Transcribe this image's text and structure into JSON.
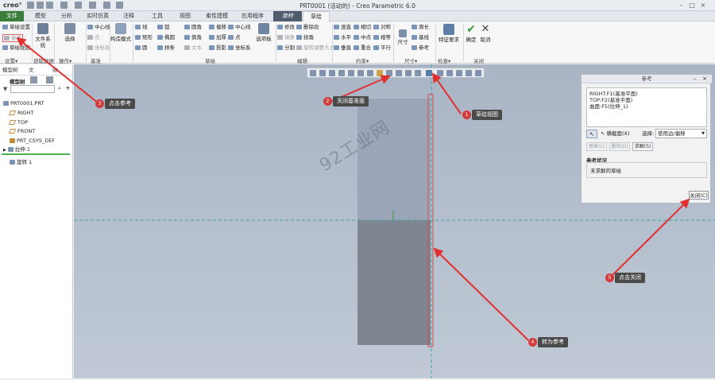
{
  "titlebar": {
    "logo": "creo°",
    "title": "PRT0001 (活动的) - Creo Parametric 6.0"
  },
  "tabs": {
    "file": "文件",
    "items": [
      "模型",
      "分析",
      "实时仿真",
      "注释",
      "工具",
      "视图",
      "柔性建模",
      "应用程序"
    ],
    "context": "旋转",
    "active": "草绘"
  },
  "ribbon": {
    "setup": {
      "sketch_setup": "草绘设置",
      "references": "参考",
      "sketch_view": "草绘视图",
      "label": "设置▾"
    },
    "get_data": {
      "file_system": "文件系统",
      "label": "获取数据"
    },
    "operations": {
      "select": "选择",
      "label": "操作▾"
    },
    "datum": {
      "centerline": "中心线",
      "point": "点",
      "csys": "坐标系",
      "label": "基准"
    },
    "construction": {
      "label": "构造模式"
    },
    "sketch": {
      "line": "线",
      "rectangle": "矩形",
      "circle": "圆",
      "arc": "弧",
      "ellipse": "椭圆",
      "spline": "样条",
      "fillet": "圆角",
      "chamfer": "倒角",
      "text": "文本",
      "offset": "偏移",
      "thicken": "加厚",
      "project": "投影",
      "centerline": "中心线",
      "point": "点",
      "csys": "坐标系",
      "palette": "选项板",
      "label": "草绘"
    },
    "editing": {
      "modify": "修改",
      "delete_segment": "删除段",
      "mirror": "镜像",
      "corner": "拐角",
      "divide": "分割",
      "rotate_resize": "旋转调整大小",
      "label": "编辑"
    },
    "constrain": {
      "vertical": "竖直",
      "horizontal": "水平",
      "perpendicular": "垂直",
      "tangent": "相切",
      "midpoint": "中点",
      "coincident": "重合",
      "symmetric": "对称",
      "equal": "相等",
      "parallel": "平行",
      "label": "约束▾"
    },
    "dimension": {
      "dimension": "尺寸",
      "perimeter": "周长",
      "baseline": "基线",
      "reference": "参考",
      "label": "尺寸▾"
    },
    "inspect": {
      "feature_req": "特征要求",
      "label": "检查▾"
    },
    "close": {
      "ok": "确定",
      "cancel": "取消",
      "label": "关闭"
    }
  },
  "left_panel": {
    "tabs": [
      "模型树",
      "文",
      "收"
    ],
    "tree_label": "模型树",
    "items": [
      "PRT0001.PRT",
      "RIGHT",
      "TOP",
      "FRONT",
      "PRT_CSYS_DEF",
      "拉伸 1",
      "旋转 1"
    ]
  },
  "ref_dialog": {
    "title": "参考",
    "references": [
      "RIGHT:F1(基准平面)",
      "TOP:F2(基准平面)",
      "曲面:F5(拉伸_1)"
    ],
    "xsec_label": "横截面(X)",
    "select_label": "选择:",
    "select_value": "使用边/偏移",
    "replace": "替换(L)",
    "delete": "删除(D)",
    "solve": "求解(S)",
    "status_label": "参考状况",
    "status_value": "未求解的草绘",
    "close": "关闭(C)"
  },
  "annotations": [
    {
      "num": "1",
      "text": "草绘视图"
    },
    {
      "num": "2",
      "text": "关闭基准面"
    },
    {
      "num": "3",
      "text": "点击参考"
    },
    {
      "num": "4",
      "text": "转为参考"
    },
    {
      "num": "5",
      "text": "点击关闭"
    }
  ],
  "watermark": "92工业网",
  "colors": {
    "file_tab": "#3b7d3b",
    "annotation_red": "#d23b3b",
    "datum_line": "#3aa6a6",
    "solid_upper": "#9aa6b8",
    "solid_lower": "#7f8591"
  }
}
